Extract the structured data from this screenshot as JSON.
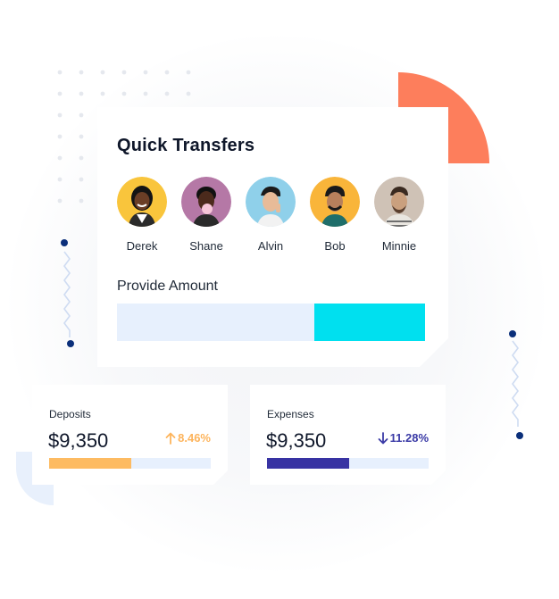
{
  "quick_transfers": {
    "title": "Quick Transfers",
    "people": [
      {
        "name": "Derek",
        "bg": "#f9c53c"
      },
      {
        "name": "Shane",
        "bg": "#b578a6"
      },
      {
        "name": "Alvin",
        "bg": "#8fd0ea"
      },
      {
        "name": "Bob",
        "bg": "#f9b53a"
      },
      {
        "name": "Minnie",
        "bg": "#cfc2b6"
      }
    ],
    "amount_label": "Provide Amount",
    "amount_fill_fraction": 0.36
  },
  "deposits": {
    "label": "Deposits",
    "value": "$9,350",
    "change": "8.46%",
    "direction": "up",
    "change_color": "#fdb45c",
    "bar_fraction": 0.51,
    "bar_color": "#fdbb62"
  },
  "expenses": {
    "label": "Expenses",
    "value": "$9,350",
    "change": "11.28%",
    "direction": "down",
    "change_color": "#3a3aa6",
    "bar_fraction": 0.51,
    "bar_color": "#3833a3"
  },
  "colors": {
    "accent_cyan": "#00e0ef",
    "accent_orange": "#fd7e5c",
    "track": "#e7f0fd",
    "decor_navy": "#0b2f7a"
  }
}
